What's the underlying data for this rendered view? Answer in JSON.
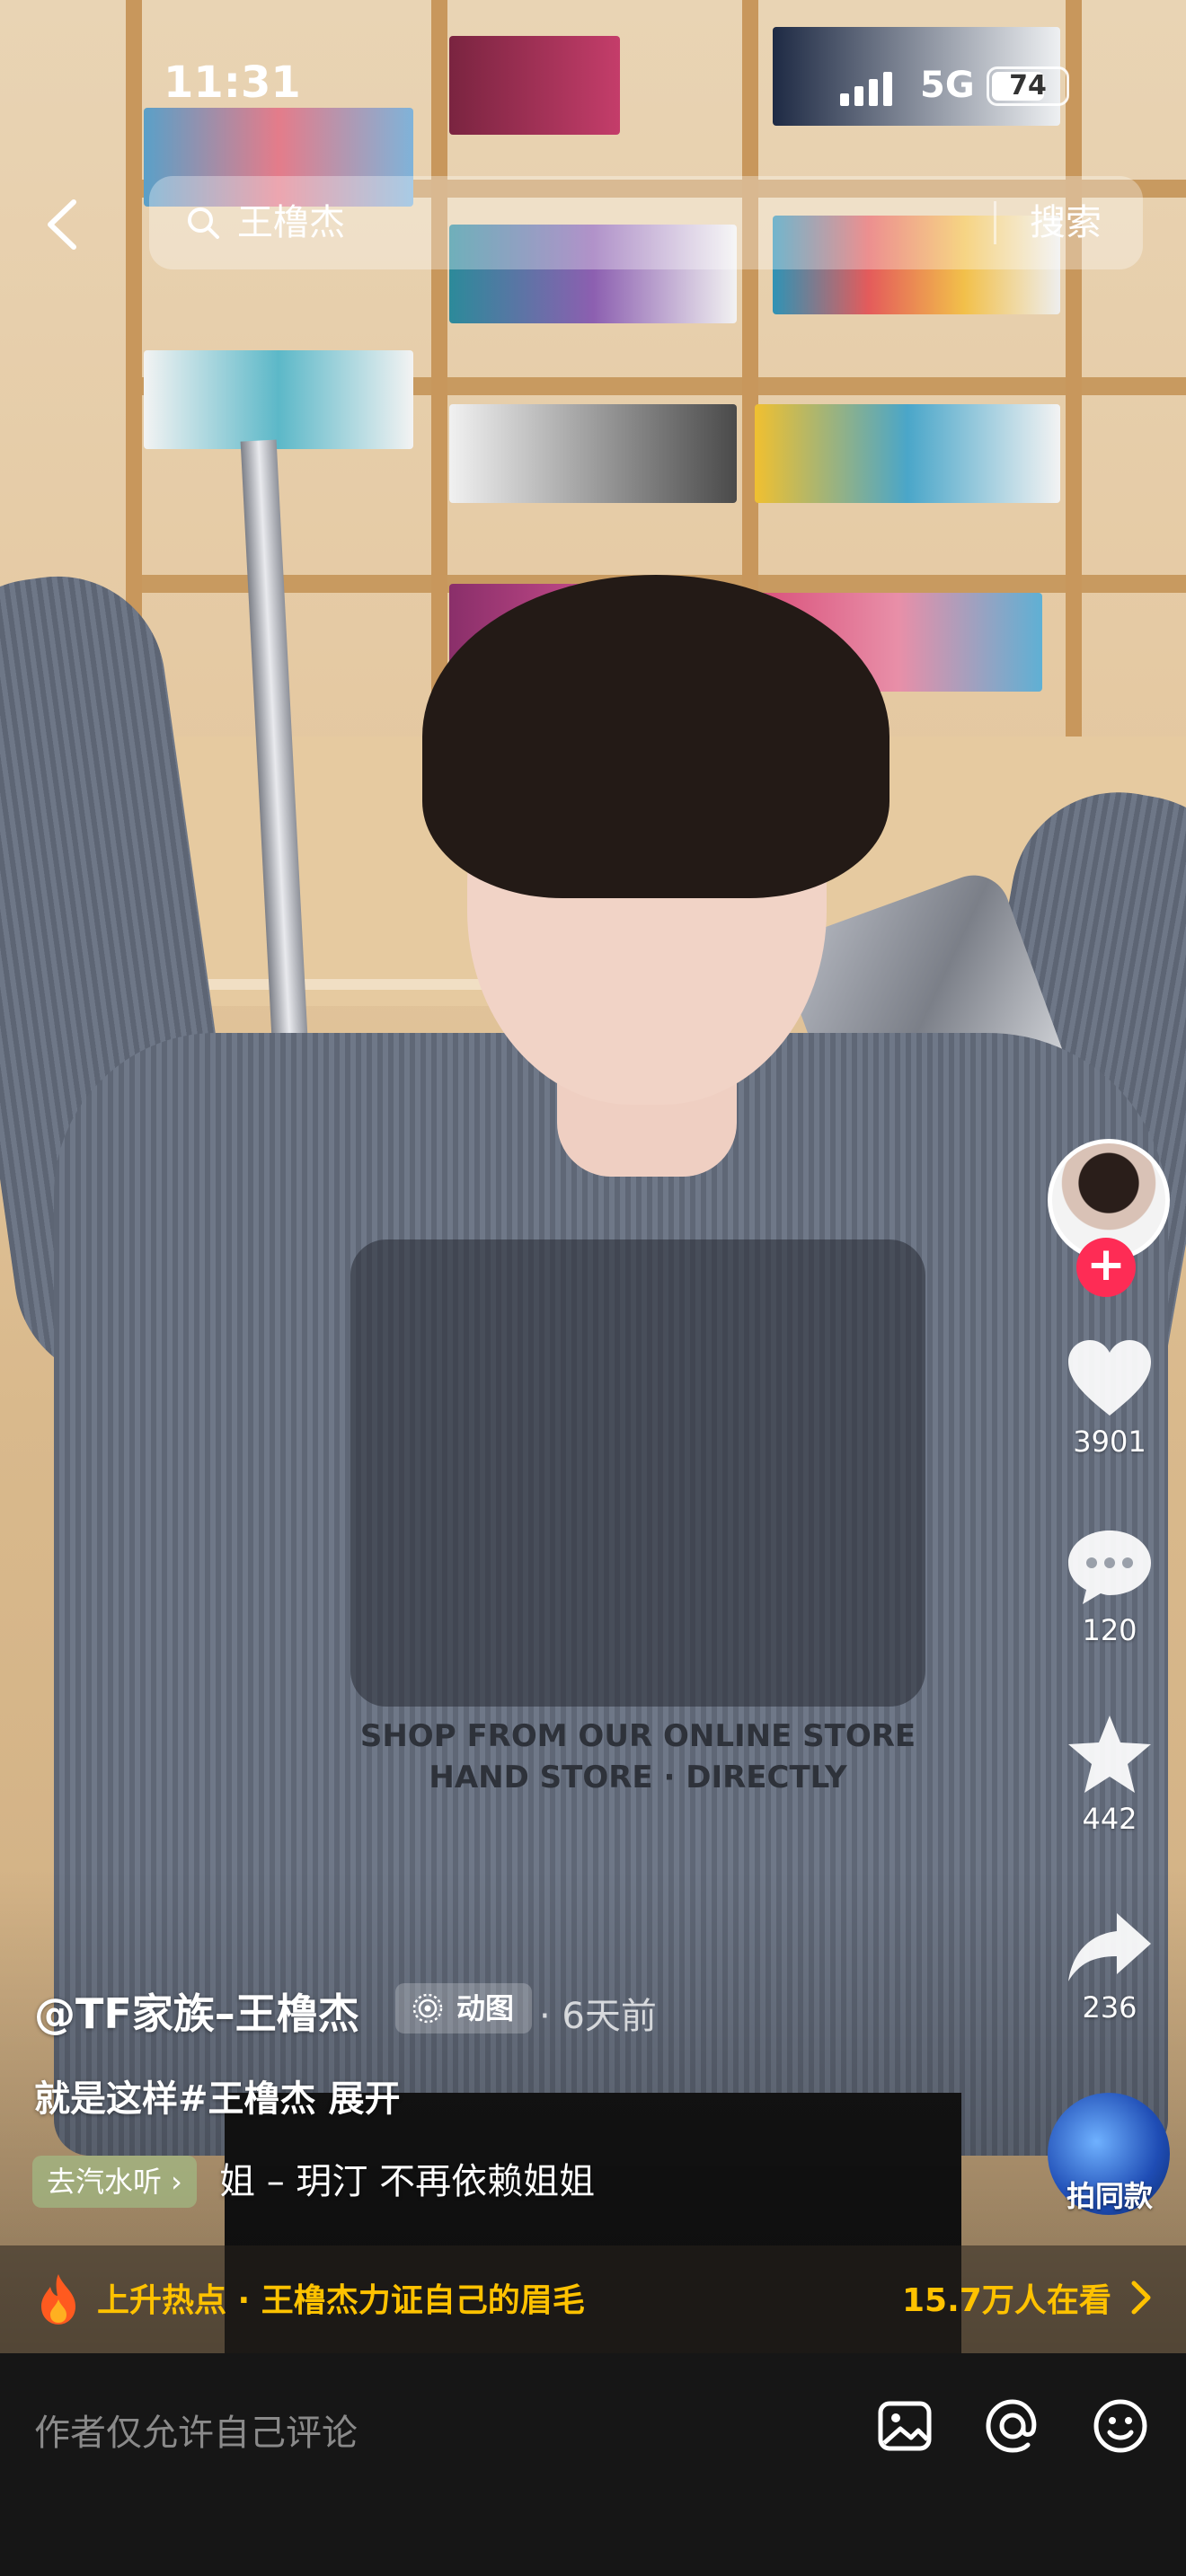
{
  "status_bar": {
    "time": "11:31",
    "network": "5G",
    "battery": "74"
  },
  "search": {
    "query": "王橹杰",
    "button": "搜索"
  },
  "icons": {
    "back": "chevron-left-icon",
    "search": "magnifier-icon",
    "like": "heart-icon",
    "comment": "speech-bubble-icon",
    "favorite": "star-icon",
    "share": "share-arrow-icon",
    "gif": "live-photo-icon",
    "fire": "fire-icon",
    "image": "image-icon",
    "mention": "at-icon",
    "emoji": "smile-icon"
  },
  "rail": {
    "likes": "3901",
    "comments": "120",
    "favorites": "442",
    "shares": "236",
    "same_style": "拍同款",
    "follow": "+"
  },
  "caption": {
    "author": "@TF家族–王橹杰",
    "badge": "动图",
    "time_ago": "· 6天前",
    "description": "就是这样#王橹杰  展开",
    "music_tag": "去汽水听 ›",
    "music_title": "姐 – 玥汀    不再依赖姐姐"
  },
  "video_print": {
    "line1": "SHOP FROM OUR ONLINE STORE",
    "line2": "HAND STORE · DIRECTLY"
  },
  "hot_bar": {
    "text": "上升热点 · 王橹杰力证自己的眉毛",
    "count": "15.7万人在看"
  },
  "comment_bar": {
    "placeholder": "作者仅允许自己评论"
  },
  "colors": {
    "accent": "#fe2c55",
    "hot": "#ffc200"
  }
}
